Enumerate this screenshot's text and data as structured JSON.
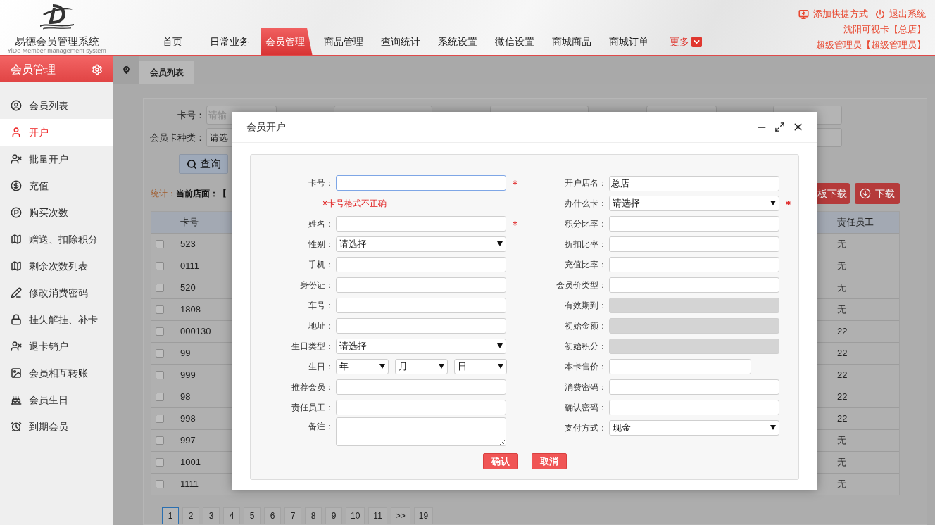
{
  "header": {
    "logo_title": "易德会员管理系统",
    "logo_subtitle": "YiDe Member management system",
    "nav": [
      {
        "label": "首页",
        "selected": false,
        "kind": "link"
      },
      {
        "label": "日常业务",
        "selected": false,
        "kind": "link"
      },
      {
        "label": "会员管理",
        "selected": true,
        "kind": "link"
      },
      {
        "label": "商品管理",
        "selected": false,
        "kind": "link"
      },
      {
        "label": "查询统计",
        "selected": false,
        "kind": "link"
      },
      {
        "label": "系统设置",
        "selected": false,
        "kind": "link"
      },
      {
        "label": "微信设置",
        "selected": false,
        "kind": "link"
      },
      {
        "label": "商城商品",
        "selected": false,
        "kind": "link"
      },
      {
        "label": "商城订单",
        "selected": false,
        "kind": "link"
      },
      {
        "label": "更多",
        "selected": false,
        "kind": "more"
      }
    ],
    "user_links": [
      {
        "label": "添加快捷方式",
        "kind": "shortcut"
      },
      {
        "label": "退出系统",
        "kind": "logout"
      }
    ],
    "store": "沈阳可视卡【总店】",
    "user": "超级管理员【超级管理员】"
  },
  "sidebar": {
    "title": "会员管理",
    "items": [
      {
        "label": "会员列表",
        "selected": false
      },
      {
        "label": "开户",
        "selected": true
      },
      {
        "label": "批量开户",
        "selected": false
      },
      {
        "label": "充值",
        "selected": false
      },
      {
        "label": "购买次数",
        "selected": false
      },
      {
        "label": "赠送、扣除积分",
        "selected": false
      },
      {
        "label": "剩余次数列表",
        "selected": false
      },
      {
        "label": "修改消费密码",
        "selected": false
      },
      {
        "label": "挂失解挂、补卡",
        "selected": false
      },
      {
        "label": "退卡销户",
        "selected": false
      },
      {
        "label": "会员相互转账",
        "selected": false
      },
      {
        "label": "会员生日",
        "selected": false
      },
      {
        "label": "到期会员",
        "selected": false
      }
    ]
  },
  "tabs": [
    {
      "label": "会员列表",
      "selected": true
    }
  ],
  "filters": {
    "card_no": {
      "label": "卡号：",
      "placeholder": "请输"
    },
    "card_type": {
      "label": "会员卡种类：",
      "value": "请选"
    },
    "search_button": "查询"
  },
  "stats": {
    "label": "统计：",
    "text": "当前店面：【"
  },
  "actions": [
    {
      "label": "板下载",
      "kind": "partial"
    },
    {
      "label": "下载",
      "kind": "download"
    }
  ],
  "table": {
    "columns": [
      "卡号",
      "责任员工"
    ],
    "rows": [
      {
        "checked": false,
        "card_no": "523",
        "staff": "无"
      },
      {
        "checked": false,
        "card_no": "0111",
        "staff": "无"
      },
      {
        "checked": false,
        "card_no": "520",
        "staff": "无"
      },
      {
        "checked": false,
        "card_no": "1808",
        "staff": "无"
      },
      {
        "checked": false,
        "card_no": "000130",
        "staff": "22"
      },
      {
        "checked": false,
        "card_no": "99",
        "staff": "22"
      },
      {
        "checked": false,
        "card_no": "999",
        "staff": "22"
      },
      {
        "checked": false,
        "card_no": "98",
        "staff": "22"
      },
      {
        "checked": false,
        "card_no": "998",
        "staff": "22"
      },
      {
        "checked": false,
        "card_no": "997",
        "staff": "无"
      },
      {
        "checked": false,
        "card_no": "1001",
        "staff": "无"
      },
      {
        "checked": false,
        "card_no": "1111",
        "staff": "无"
      }
    ]
  },
  "pagination": [
    {
      "label": "1",
      "selected": true
    },
    {
      "label": "2",
      "selected": false
    },
    {
      "label": "3",
      "selected": false
    },
    {
      "label": "4",
      "selected": false
    },
    {
      "label": "5",
      "selected": false
    },
    {
      "label": "6",
      "selected": false
    },
    {
      "label": "7",
      "selected": false
    },
    {
      "label": "8",
      "selected": false
    },
    {
      "label": "9",
      "selected": false
    },
    {
      "label": "10",
      "selected": false
    },
    {
      "label": "11",
      "selected": false
    },
    {
      "label": ">>",
      "selected": false
    },
    {
      "label": "19",
      "selected": false
    }
  ],
  "dialog": {
    "title": "会员开户",
    "left_fields": [
      {
        "label": "卡号：",
        "kind": "input",
        "required": true,
        "disabled": false,
        "focused": true
      },
      {
        "kind": "error",
        "text": "×卡号格式不正确"
      },
      {
        "label": "姓名：",
        "kind": "input",
        "required": true,
        "disabled": false,
        "focused": false
      },
      {
        "label": "性别：",
        "kind": "select",
        "value": "请选择",
        "required": false,
        "disabled": false,
        "focused": false
      },
      {
        "label": "手机：",
        "kind": "input",
        "required": false,
        "disabled": false,
        "focused": false
      },
      {
        "label": "身份证：",
        "kind": "input",
        "required": false,
        "disabled": false,
        "focused": false
      },
      {
        "label": "车号：",
        "kind": "input",
        "required": false,
        "disabled": false,
        "focused": false
      },
      {
        "label": "地址：",
        "kind": "input",
        "required": false,
        "disabled": false,
        "focused": false
      },
      {
        "label": "生日类型：",
        "kind": "select",
        "value": "请选择",
        "required": false,
        "disabled": false,
        "focused": false
      },
      {
        "label": "生日：",
        "kind": "date",
        "parts": [
          "年",
          "月",
          "日"
        ],
        "required": false,
        "disabled": false,
        "focused": false
      },
      {
        "label": "推荐会员：",
        "kind": "input",
        "required": false,
        "disabled": false,
        "focused": false
      },
      {
        "label": "责任员工：",
        "kind": "input",
        "required": false,
        "disabled": false,
        "focused": false
      },
      {
        "label": "备注：",
        "kind": "textarea",
        "required": false,
        "disabled": false,
        "focused": false
      }
    ],
    "right_fields": [
      {
        "label": "开户店名：",
        "kind": "input",
        "value": "总店",
        "required": false,
        "disabled": false,
        "focused": false
      },
      {
        "label": "办什么卡：",
        "kind": "select",
        "value": "请选择",
        "required": true,
        "disabled": false,
        "focused": false
      },
      {
        "label": "积分比率：",
        "kind": "input",
        "required": false,
        "disabled": false,
        "focused": false
      },
      {
        "label": "折扣比率：",
        "kind": "input",
        "required": false,
        "disabled": false,
        "focused": false
      },
      {
        "label": "充值比率：",
        "kind": "input",
        "required": false,
        "disabled": false,
        "focused": false
      },
      {
        "label": "会员价类型：",
        "kind": "input",
        "required": false,
        "disabled": false,
        "focused": false
      },
      {
        "label": "有效期到：",
        "kind": "input",
        "required": false,
        "disabled": true,
        "focused": false
      },
      {
        "label": "初始金额：",
        "kind": "input",
        "required": false,
        "disabled": true,
        "focused": false
      },
      {
        "label": "初始积分：",
        "kind": "input",
        "required": false,
        "disabled": true,
        "focused": false
      },
      {
        "label": "本卡售价：",
        "kind": "short-input",
        "required": false,
        "disabled": false,
        "focused": false
      },
      {
        "label": "消费密码：",
        "kind": "input",
        "required": false,
        "disabled": false,
        "focused": false
      },
      {
        "label": "确认密码：",
        "kind": "input",
        "required": false,
        "disabled": false,
        "focused": false
      },
      {
        "label": "支付方式：",
        "kind": "select",
        "value": "现金",
        "required": false,
        "disabled": false,
        "focused": false
      }
    ],
    "buttons": [
      "确认",
      "取消"
    ]
  }
}
